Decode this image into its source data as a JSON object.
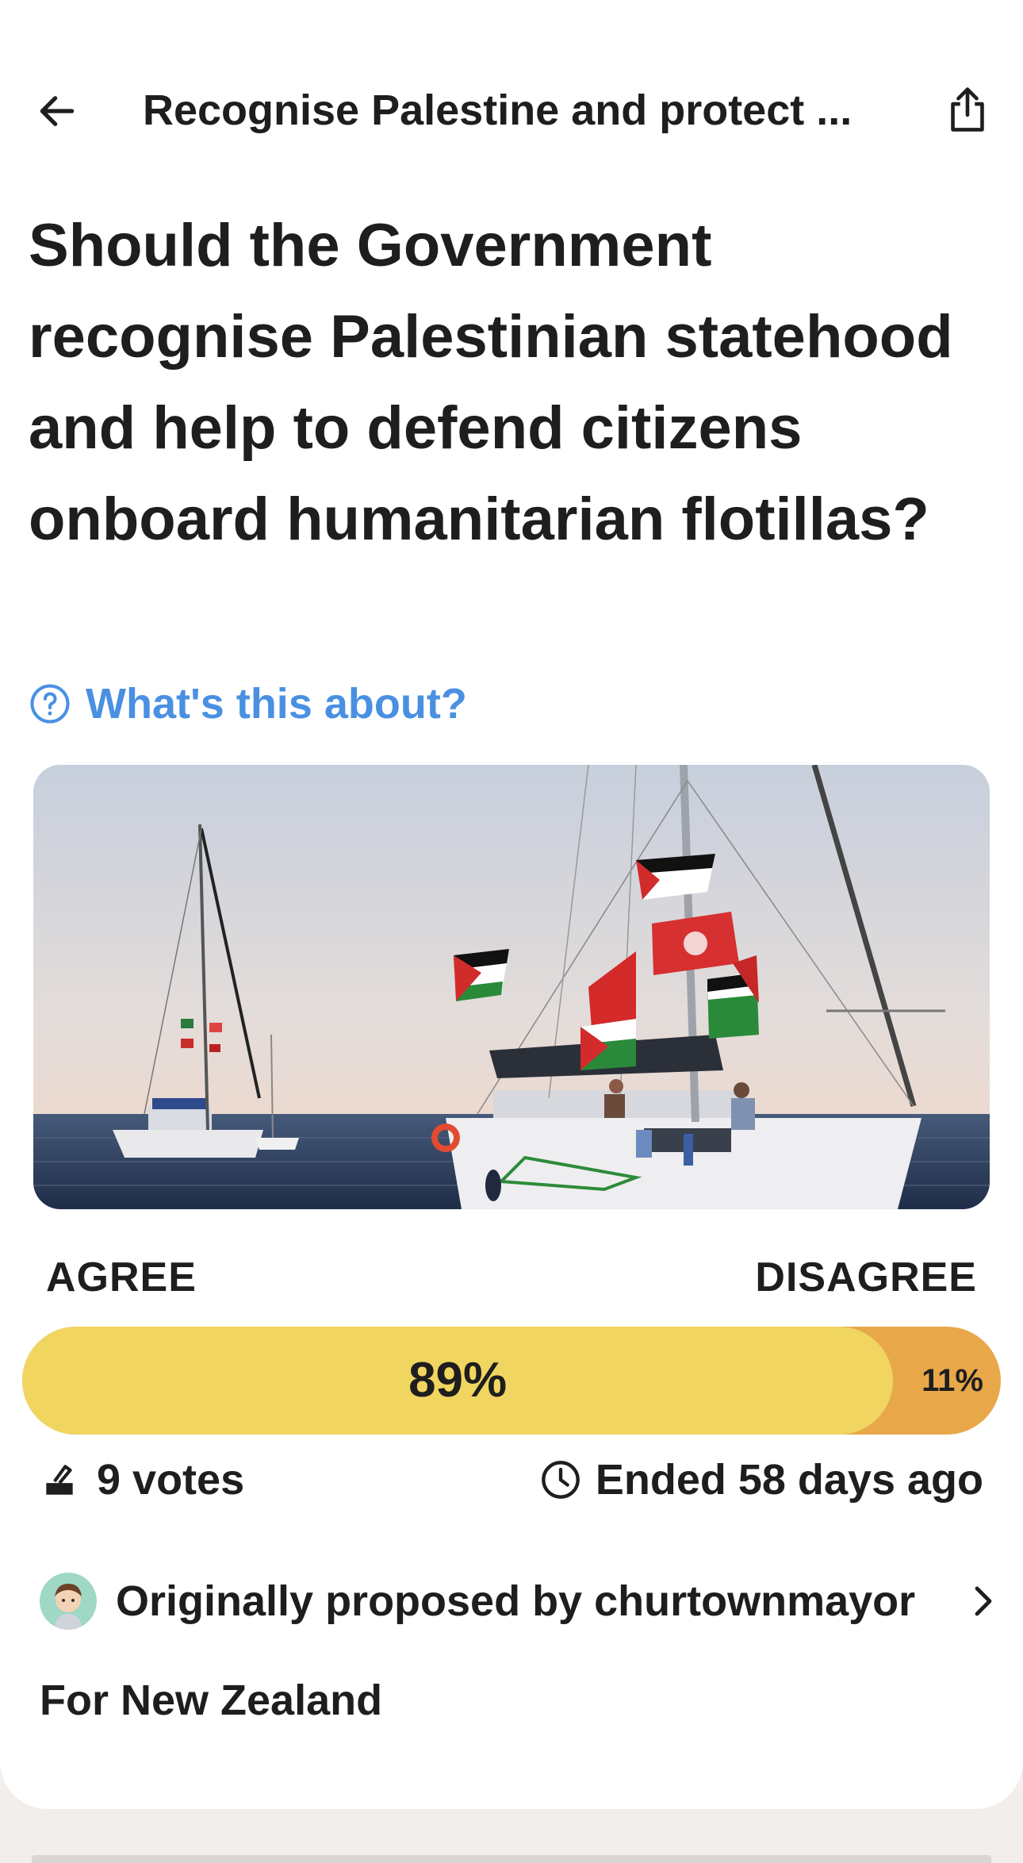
{
  "header": {
    "title": "Recognise Palestine and protect ...",
    "back_icon": "arrow-left-icon",
    "share_icon": "share-icon"
  },
  "question": "Should the Government recognise Palestinian statehood and help to defend citizens onboard humanitarian flotillas?",
  "about_link": {
    "label": "What's this about?",
    "icon": "question-circle-icon",
    "color": "#4a90e2"
  },
  "image": {
    "description_icon": "sailboats-with-flags-image"
  },
  "results": {
    "agree_label": "AGREE",
    "disagree_label": "DISAGREE",
    "agree_fraction": 0.89,
    "agree_text": "89%",
    "disagree_text": "11%",
    "agree_color": "#f0d560",
    "disagree_color": "#e8a84a"
  },
  "stats": {
    "votes": "9 votes",
    "votes_icon": "ballot-box-icon",
    "ended": "Ended 58 days ago",
    "ended_icon": "clock-icon"
  },
  "proposer": {
    "text": "Originally proposed by churtownmayor",
    "avatar_icon": "avatar",
    "chevron_icon": "chevron-right-icon"
  },
  "location": "For New Zealand"
}
